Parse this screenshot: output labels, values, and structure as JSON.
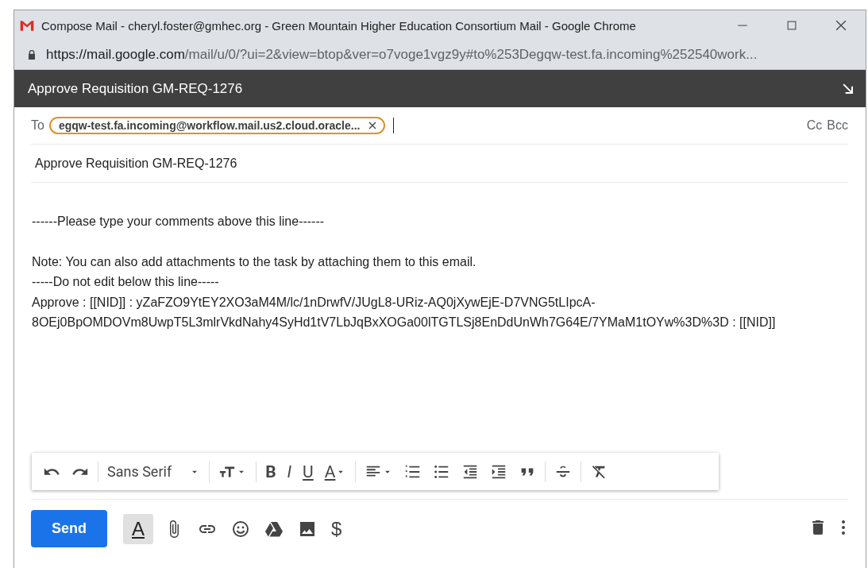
{
  "window": {
    "title": "Compose Mail - cheryl.foster@gmhec.org - Green Mountain Higher Education Consortium Mail - Google Chrome",
    "url_host": "https://mail.google.com",
    "url_path": "/mail/u/0/?ui=2&view=btop&ver=o7voge1vgz9y#to%253Degqw-test.fa.incoming%252540work..."
  },
  "compose": {
    "title": "Approve Requisition GM-REQ-1276",
    "to_label": "To",
    "recipients": [
      "egqw-test.fa.incoming@workflow.mail.us2.cloud.oracle..."
    ],
    "cc": "Cc",
    "bcc": "Bcc",
    "subject": "Approve Requisition GM-REQ-1276",
    "body": [
      [
        "------Please type your comments above this line------"
      ],
      [
        "Note: You can also add attachments to the task by attaching them to this email.",
        "-----Do not edit below this line-----",
        "Approve : [[NID]] : yZaFZO9YtEY2XO3aM4M/lc/1nDrwfV/JUgL8-URiz-AQ0jXywEjE-D7VNG5tLIpcA-",
        "8OEj0BpOMDOVm8UwpT5L3mlrVkdNahy4SyHd1tV7LbJqBxXOGa00lTGTLSj8EnDdUnWh7G64E/7YMaM1tOYw%3D%3D : [[NID]]"
      ]
    ]
  },
  "format_bar": {
    "font": "Sans Serif",
    "bold": "B",
    "italic": "I",
    "underline": "U",
    "text_color": "A"
  },
  "bottom_bar": {
    "send": "Send",
    "formatting": "A",
    "formatting_on": true,
    "money": "$"
  }
}
